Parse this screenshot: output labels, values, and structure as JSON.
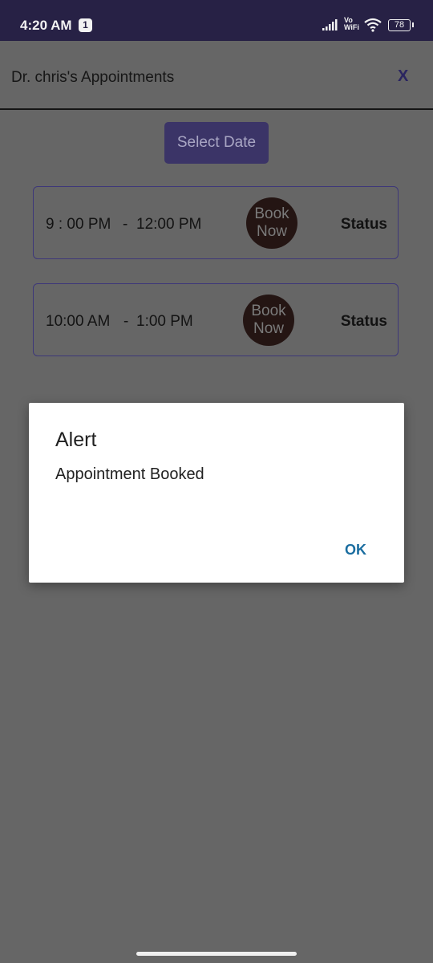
{
  "status_bar": {
    "time": "4:20 AM",
    "notification_badge": "1",
    "network_label_top": "Vo",
    "network_label_bottom": "WiFi",
    "battery": "78"
  },
  "header": {
    "title": "Dr. chris's Appointments",
    "close_label": "X"
  },
  "select_date_label": "Select Date",
  "slots": [
    {
      "start": "9 : 00 PM",
      "separator": "-",
      "end": "12:00 PM",
      "book_line1": "Book",
      "book_line2": "Now",
      "status": "Status"
    },
    {
      "start": "10:00 AM",
      "separator": "-",
      "end": "1:00 PM",
      "book_line1": "Book",
      "book_line2": "Now",
      "status": "Status"
    }
  ],
  "dialog": {
    "title": "Alert",
    "message": "Appointment Booked",
    "ok_label": "OK"
  },
  "colors": {
    "status_bar_bg": "#272145",
    "accent": "#3b3467",
    "dialog_button": "#1a6da0"
  }
}
